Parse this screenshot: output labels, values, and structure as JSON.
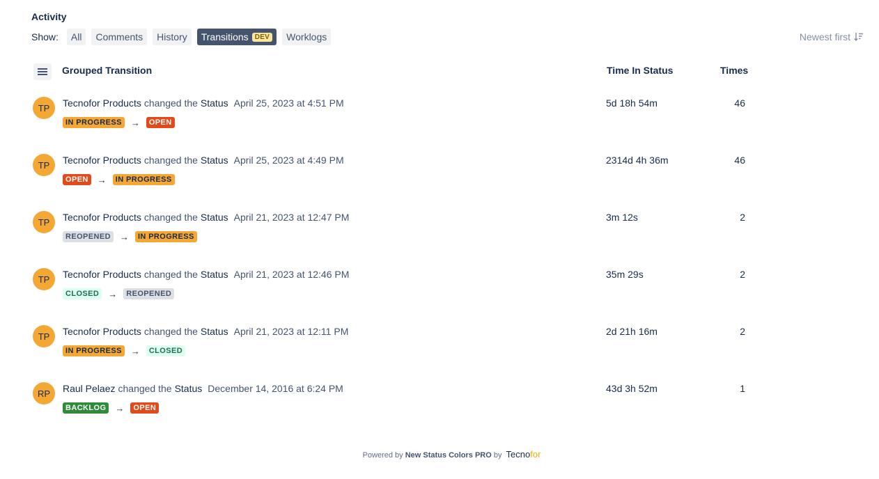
{
  "header": {
    "title": "Activity",
    "show_label": "Show:",
    "filters": [
      {
        "label": "All",
        "active": false
      },
      {
        "label": "Comments",
        "active": false
      },
      {
        "label": "History",
        "active": false
      },
      {
        "label": "Transitions",
        "active": true,
        "badge": "DEV"
      },
      {
        "label": "Worklogs",
        "active": false
      }
    ],
    "sort_label": "Newest first",
    "sort_icon": "sort-descending-icon"
  },
  "columns": {
    "menu_icon": "hamburger-menu-icon",
    "grouped_transition": "Grouped Transition",
    "time_in_status": "Time In Status",
    "times": "Times"
  },
  "status_styles": {
    "IN PROGRESS": {
      "bg": "#f5a733",
      "fg": "#172b4d"
    },
    "OPEN": {
      "bg": "#e34a1a",
      "fg": "#ffffff"
    },
    "REOPENED": {
      "bg": "#dcdfe4",
      "fg": "#44546f"
    },
    "CLOSED": {
      "bg": "#dcfff1",
      "fg": "#216e4e"
    },
    "BACKLOG": {
      "bg": "#2f8a3a",
      "fg": "#ffffff"
    }
  },
  "transitions": [
    {
      "initials": "TP",
      "author": "Tecnofor Products",
      "action": "changed the",
      "field": "Status",
      "date": "April 25, 2023 at 4:51 PM",
      "from": "IN PROGRESS",
      "to": "OPEN",
      "arrow": "→",
      "time_in_status": "5d 18h 54m",
      "times": "46"
    },
    {
      "initials": "TP",
      "author": "Tecnofor Products",
      "action": "changed the",
      "field": "Status",
      "date": "April 25, 2023 at 4:49 PM",
      "from": "OPEN",
      "to": "IN PROGRESS",
      "arrow": "→",
      "time_in_status": "2314d 4h 36m",
      "times": "46"
    },
    {
      "initials": "TP",
      "author": "Tecnofor Products",
      "action": "changed the",
      "field": "Status",
      "date": "April 21, 2023 at 12:47 PM",
      "from": "REOPENED",
      "to": "IN PROGRESS",
      "arrow": "→",
      "time_in_status": "3m 12s",
      "times": "2"
    },
    {
      "initials": "TP",
      "author": "Tecnofor Products",
      "action": "changed the",
      "field": "Status",
      "date": "April 21, 2023 at 12:46 PM",
      "from": "CLOSED",
      "to": "REOPENED",
      "arrow": "→",
      "time_in_status": "35m 29s",
      "times": "2"
    },
    {
      "initials": "TP",
      "author": "Tecnofor Products",
      "action": "changed the",
      "field": "Status",
      "date": "April 21, 2023 at 12:11 PM",
      "from": "IN PROGRESS",
      "to": "CLOSED",
      "arrow": "→",
      "time_in_status": "2d 21h 16m",
      "times": "2"
    },
    {
      "initials": "RP",
      "author": "Raul Pelaez",
      "action": "changed the",
      "field": "Status",
      "date": "December 14, 2016 at 6:24 PM",
      "from": "BACKLOG",
      "to": "OPEN",
      "arrow": "→",
      "time_in_status": "43d 3h 52m",
      "times": "1"
    }
  ],
  "footer": {
    "powered_by": "Powered by",
    "product": "New Status Colors PRO",
    "by": "by",
    "brand_main": "Tecno",
    "brand_accent": "for"
  }
}
